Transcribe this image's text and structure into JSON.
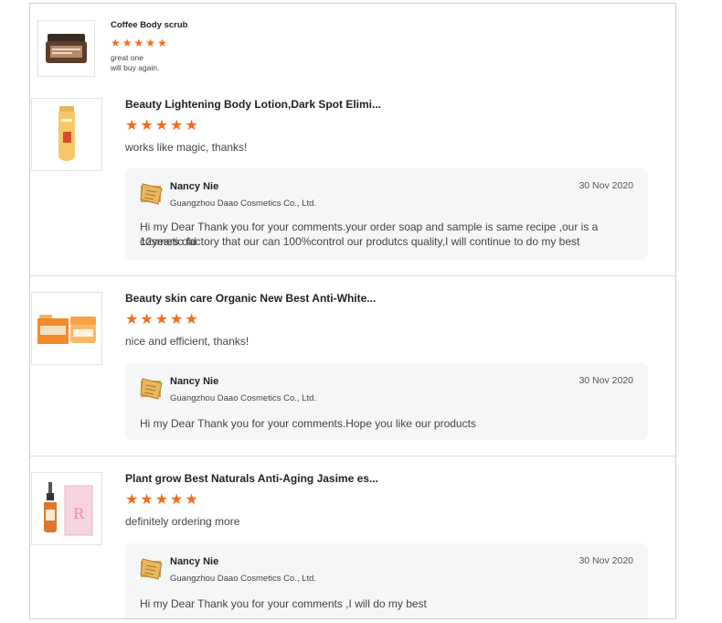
{
  "reviews": [
    {
      "title": "Coffee Body scrub",
      "rating": 5,
      "comment_lines": [
        "great one",
        "will buy again."
      ],
      "reply": null
    },
    {
      "title": "Beauty Lightening Body Lotion,Dark Spot Elimi...",
      "rating": 5,
      "comment": "works like magic, thanks!",
      "reply": {
        "name": "Nancy Nie",
        "company": "Guangzhou Daao Cosmetics Co., Ltd.",
        "date": "30 Nov 2020",
        "text_lines": [
          "Hi my Dear Thank you for your comments.your order soap and sample is same recipe ,our is a 12years old",
          "cosmetic factory  that our can 100%control our produtcs quality,I will continue to do my best"
        ]
      }
    },
    {
      "title": "Beauty skin care Organic New Best Anti-White...",
      "rating": 5,
      "comment": "nice and efficient, thanks!",
      "reply": {
        "name": "Nancy Nie",
        "company": "Guangzhou Daao Cosmetics Co., Ltd.",
        "date": "30 Nov 2020",
        "text_lines": [
          "Hi my Dear Thank you for your comments.Hope you  like our products"
        ]
      }
    },
    {
      "title": "Plant grow Best Naturals Anti-Aging Jasime es...",
      "rating": 5,
      "comment": "definitely ordering more",
      "reply": {
        "name": "Nancy Nie",
        "company": "Guangzhou Daao Cosmetics Co., Ltd.",
        "date": "30 Nov 2020",
        "text_lines": [
          "Hi my Dear Thank you for your comments ,I  will do my best"
        ]
      }
    }
  ],
  "colors": {
    "star": "#f26b1d",
    "reply_bg": "#f5f6f8",
    "divider": "#dcdcdc"
  },
  "icons": {
    "star": "star-icon",
    "avatar": "company-logo-avatar"
  }
}
